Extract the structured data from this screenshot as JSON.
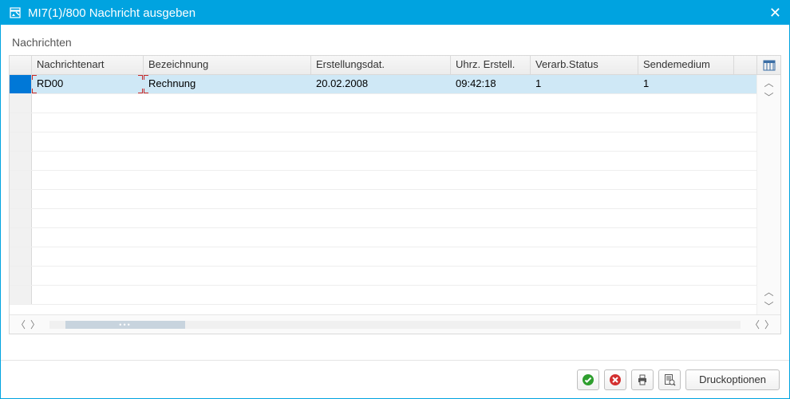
{
  "window": {
    "title": "MI7(1)/800 Nachricht ausgeben"
  },
  "panel": {
    "title": "Nachrichten"
  },
  "grid": {
    "headers": {
      "type": "Nachrichtenart",
      "desc": "Bezeichnung",
      "date": "Erstellungsdat.",
      "time": "Uhrz. Erstell.",
      "status": "Verarb.Status",
      "medium": "Sendemedium"
    },
    "rows": [
      {
        "type": "RD00",
        "desc": "Rechnung",
        "date": "20.02.2008",
        "time": "09:42:18",
        "status": "1",
        "medium": "1",
        "selected": true
      }
    ],
    "empty_row_count": 11
  },
  "footer": {
    "print_options_label": "Druckoptionen"
  }
}
